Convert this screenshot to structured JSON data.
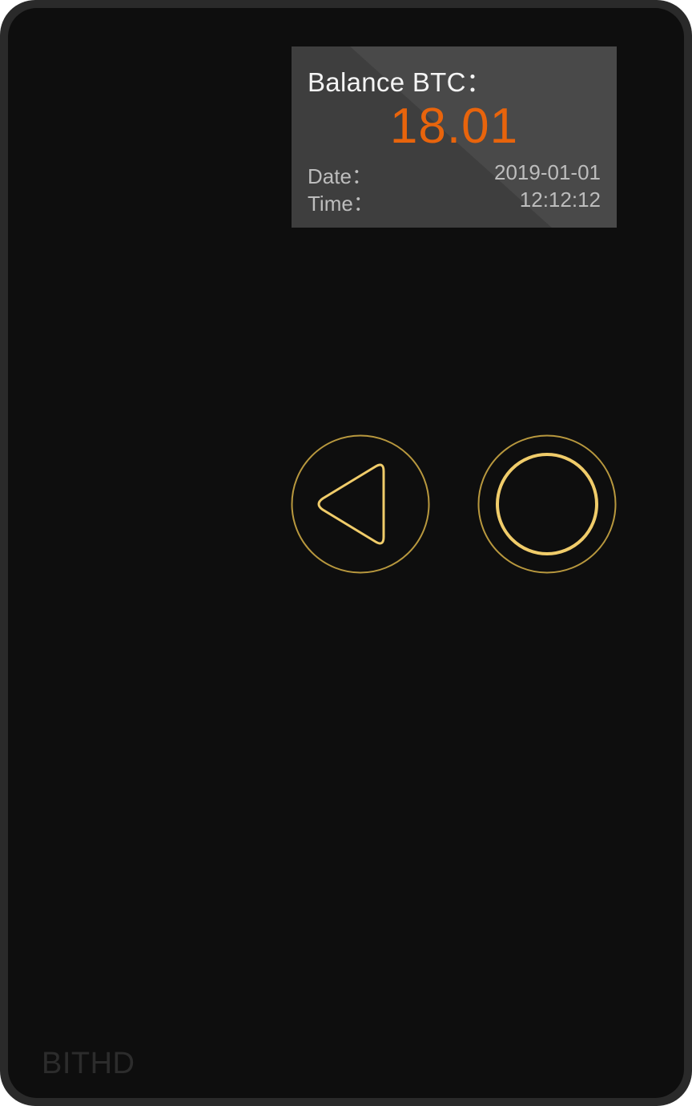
{
  "screen": {
    "balance_label": "Balance BTC：",
    "balance_value": "18.01",
    "date_label": "Date：",
    "date_value": "2019-01-01",
    "time_label": "Time：",
    "time_value": "12:12:12"
  },
  "buttons": {
    "back_icon": "triangle-left-icon",
    "confirm_icon": "circle-icon"
  },
  "brand": {
    "name": "BITHD"
  },
  "colors": {
    "device_body": "#0e0e0e",
    "device_frame": "#2a2a2a",
    "screen_bg": "#3e3e3e",
    "balance_value": "#e8640c",
    "button_gold": "#e8c25c"
  }
}
